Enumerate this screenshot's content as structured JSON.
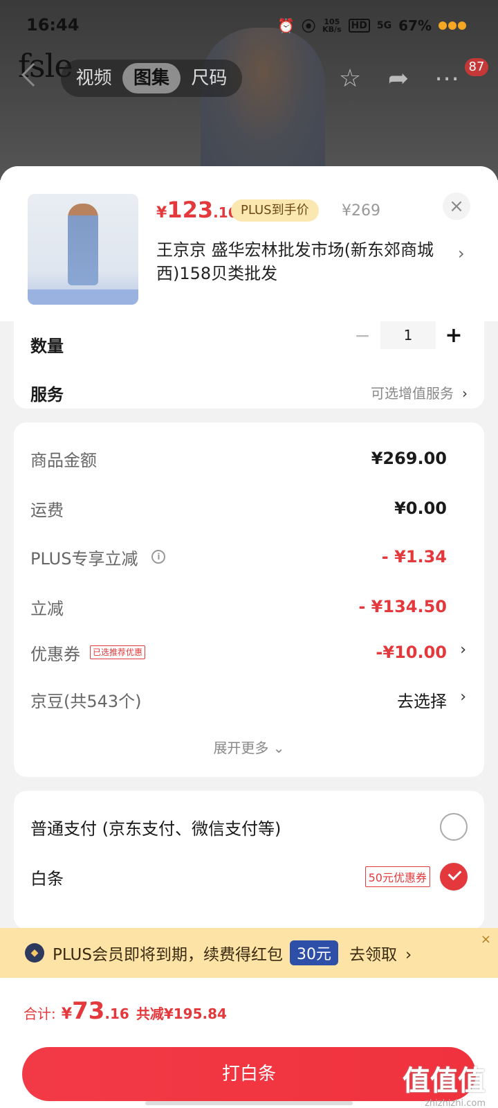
{
  "status_bar": {
    "time": "16:44",
    "net_speed_top": "105",
    "net_speed_unit": "KB/s",
    "hd": "HD",
    "signal": "5G",
    "battery": "67%"
  },
  "product_page": {
    "brand": "fsle",
    "tabs": [
      "视频",
      "图集",
      "尺码"
    ],
    "active_tab": "图集",
    "badge_count": "87"
  },
  "sheet": {
    "price_yen": "¥",
    "price_int": "123",
    "price_dec": ".16",
    "plus_tag": "PLUS到手价",
    "original_price": "¥269",
    "store_name": "王京京  盛华宏林批发市场(新东郊商城西)158贝类批发"
  },
  "quantity": {
    "label": "数量",
    "value": "1",
    "minus": "−",
    "plus": "+"
  },
  "service": {
    "label": "服务",
    "value": "可选增值服务"
  },
  "summary": {
    "rows": [
      {
        "label": "商品金额",
        "amount": "¥269.00"
      },
      {
        "label": "运费",
        "amount": "¥0.00"
      },
      {
        "label": "PLUS专享立减",
        "amount": "- ¥1.34"
      },
      {
        "label": "立减",
        "amount": "- ¥134.50"
      },
      {
        "label": "优惠券",
        "tag": "已选推荐优惠",
        "amount": "-¥10.00"
      },
      {
        "label": "京豆(共543个)",
        "amount": "去选择"
      }
    ],
    "expand": "展开更多"
  },
  "payment": {
    "normal": "普通支付 (京东支付、微信支付等)",
    "baitiao": "白条",
    "baitiao_coupon": "50元优惠券"
  },
  "plus_banner": {
    "text": "PLUS会员即将到期，续费得红包",
    "amount": "30元",
    "action": "去领取",
    "close": "×"
  },
  "bottom": {
    "total_label": "合计:",
    "total_yen": "¥",
    "total_int": "73",
    "total_dec": ".16",
    "saved": "共减¥195.84",
    "pay_button": "打白条",
    "watermark_big": "值值值",
    "watermark_small": "zhizhizhi.com"
  },
  "colors": {
    "accent_red": "#e4393c",
    "plus_gold": "#fbe7b0",
    "plus_blue": "#2d4fa8"
  },
  "icons": {
    "back": "chevron-left-icon",
    "favorite": "star-icon",
    "share": "share-icon",
    "more": "more-icon",
    "close": "close-icon",
    "info": "info-icon",
    "chevron": "chevron-right-icon",
    "check": "check-icon"
  }
}
